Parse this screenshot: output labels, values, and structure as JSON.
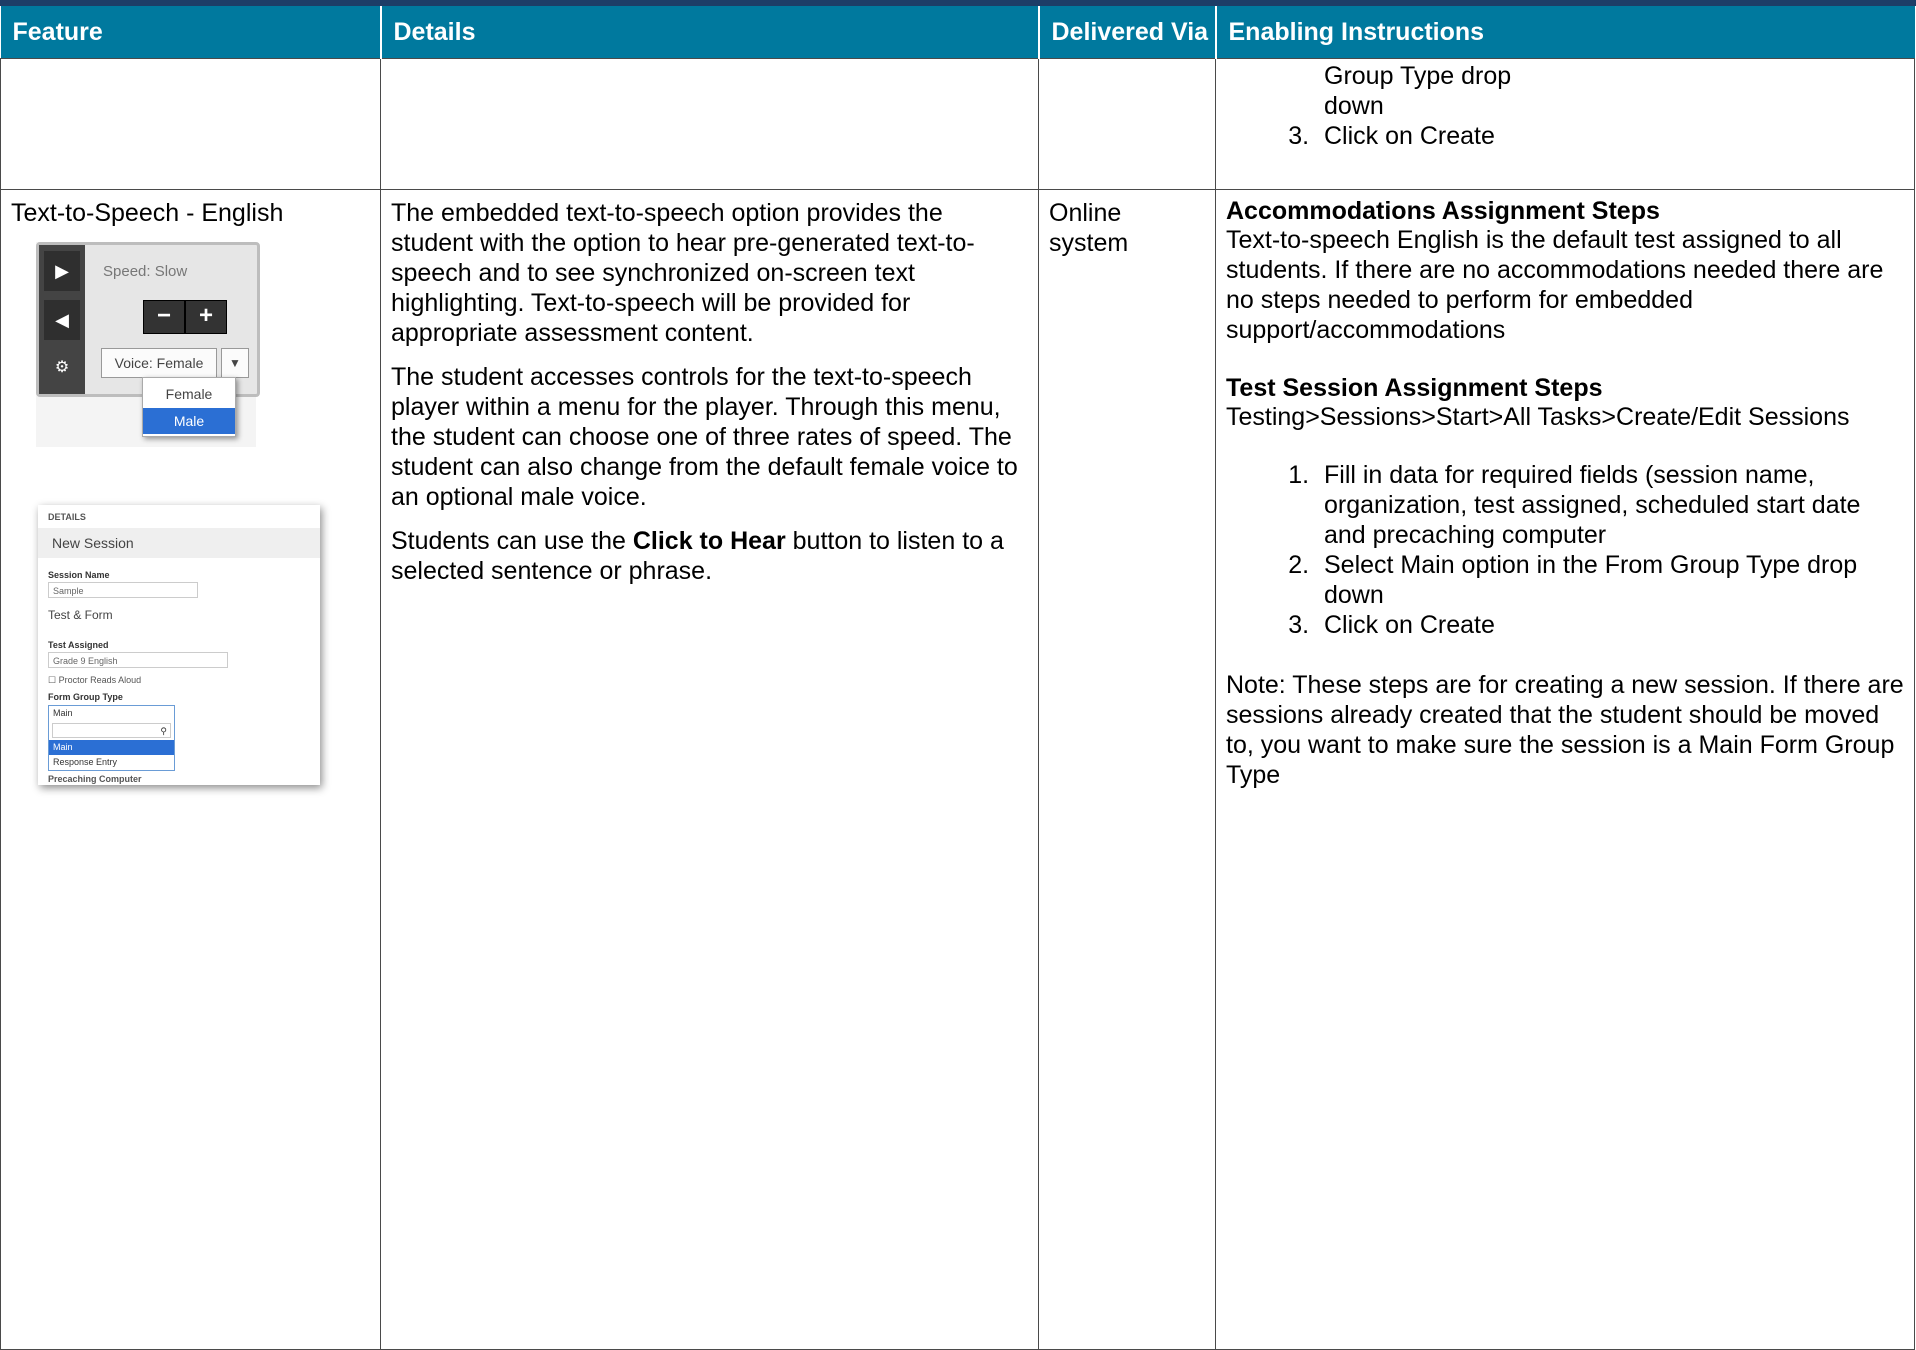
{
  "header": {
    "feature": "Feature",
    "details": "Details",
    "delivered_via": "Delivered Via",
    "enabling_instructions": "Enabling Instructions"
  },
  "row1": {
    "step2_cont_line1": "Group Type drop",
    "step2_cont_line2": "down",
    "step3": "Click on Create"
  },
  "row2": {
    "feature": "Text-to-Speech - English",
    "details": {
      "p1": "The embedded text-to-speech option provides the student with the option to hear pre-generated text-to-speech and to see synchronized on-screen text highlighting. Text-to-speech will be provided for appropriate assessment content.",
      "p2": "The student accesses controls for the text-to-speech player within a menu for the player. Through this menu, the student can choose one of three rates of speed. The student can also change from the default female voice to an optional male voice.",
      "p3_before": "Students can use the ",
      "p3_bold": "Click to Hear",
      "p3_after": " button to listen to a selected sentence or phrase."
    },
    "delivered_via": "Online system",
    "instructions": {
      "acc_title": "Accommodations Assignment Steps",
      "acc_text": "Text-to-speech English is the default test assigned to all students.  If there are no accommodations needed there are no steps needed to perform for embedded support/accommodations",
      "session_title": "Test Session Assignment Steps",
      "session_path": "Testing>Sessions>Start>All Tasks>Create/Edit Sessions",
      "steps": [
        "Fill in data for required fields (session name, organization, test assigned, scheduled start date and precaching computer",
        "Select Main option in the From Group Type drop down",
        "Click on Create"
      ],
      "note": "Note: These steps are for creating a new session.  If there are sessions already created that the student should be moved to, you want to make sure the session is a Main Form Group Type"
    },
    "tts_widget": {
      "speed": "Speed: Slow",
      "minus": "−",
      "plus": "+",
      "voice": "Voice: Female",
      "options": [
        "Female",
        "Male"
      ],
      "icons": [
        "play-icon",
        "megaphone-icon",
        "gear-icon",
        "caret-down-icon"
      ]
    },
    "session_form": {
      "details": "DETAILS",
      "new_session": "New Session",
      "session_name_label": "Session Name",
      "session_name_value": "Sample",
      "test_form": "Test & Form",
      "test_assigned_label": "Test Assigned",
      "test_assigned_value": "Grade 9 English",
      "proctor": "Proctor Reads Aloud",
      "form_group_label": "Form Group Type",
      "form_group_value": "Main",
      "options": [
        "Main",
        "Response Entry"
      ],
      "footer": "Precaching Computer"
    }
  }
}
